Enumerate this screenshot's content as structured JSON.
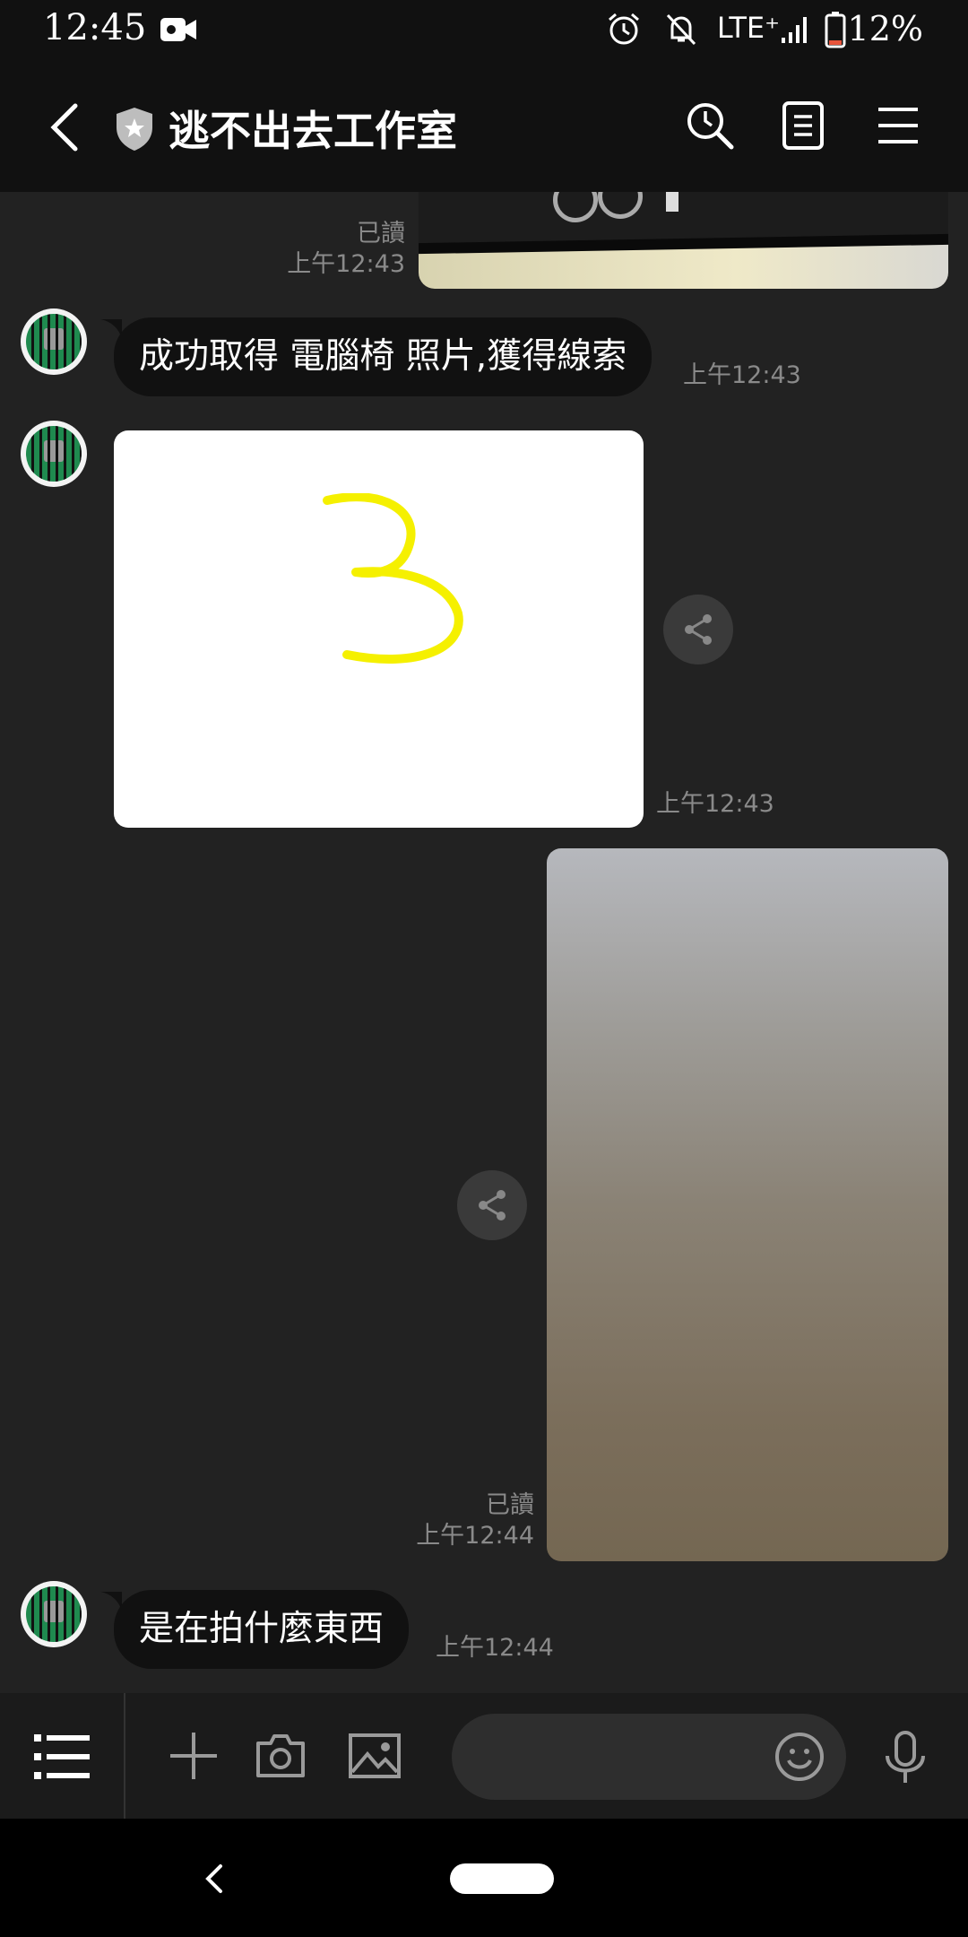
{
  "status_bar": {
    "time": "12:45",
    "network": "LTE⁺",
    "battery": "12%"
  },
  "header": {
    "title": "逃不出去工作室"
  },
  "messages": [
    {
      "read_label": "已讀",
      "time": "上午12:43"
    },
    {
      "text": "成功取得 電腦椅 照片,獲得線索",
      "time": "上午12:43"
    },
    {
      "image_digit": "3",
      "time": "上午12:43"
    },
    {
      "read_label": "已讀",
      "time": "上午12:44"
    },
    {
      "text": "是在拍什麼東西",
      "time": "上午12:44"
    }
  ],
  "colors": {
    "background": "#222222",
    "bar": "#111111",
    "drawing_yellow": "#f5f000",
    "timestamp": "#8a8a8a"
  }
}
